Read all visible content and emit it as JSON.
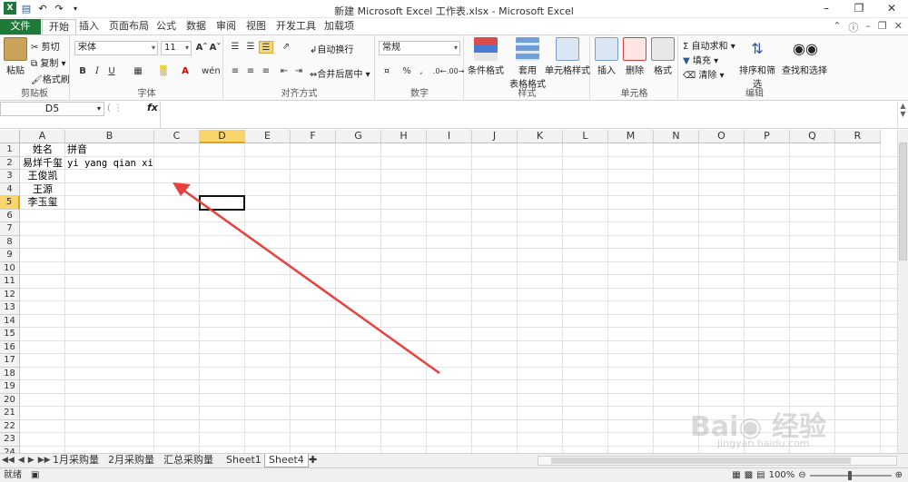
{
  "window": {
    "title": "新建 Microsoft Excel 工作表.xlsx - Microsoft Excel"
  },
  "tabs": [
    "文件",
    "开始",
    "插入",
    "页面布局",
    "公式",
    "数据",
    "审阅",
    "视图",
    "开发工具",
    "加载项"
  ],
  "ribbon": {
    "clipboard": {
      "paste": "粘贴",
      "cut": "剪切",
      "copy": "复制",
      "format_painter": "格式刷",
      "label": "剪贴板"
    },
    "font": {
      "name": "宋体",
      "size": "11",
      "bold": "B",
      "italic": "I",
      "underline": "U",
      "label": "字体",
      "phonetic": "wén"
    },
    "alignment": {
      "wrap": "自动换行",
      "merge": "合并后居中",
      "label": "对齐方式"
    },
    "number": {
      "format": "常规",
      "percent": "%",
      "comma": ",",
      "label": "数字"
    },
    "styles": {
      "conditional": "条件格式",
      "table": "套用",
      "table2": "表格格式",
      "cell": "单元格样式",
      "label": "样式"
    },
    "cells": {
      "insert": "插入",
      "delete": "删除",
      "format": "格式",
      "label": "单元格"
    },
    "editing": {
      "autosum": "自动求和",
      "fill": "填充",
      "clear": "清除",
      "sort": "排序和筛选",
      "find": "查找和选择",
      "label": "编辑"
    }
  },
  "formula_bar": {
    "name_box": "D5",
    "fx": "fx",
    "value": ""
  },
  "columns": [
    "A",
    "B",
    "C",
    "D",
    "E",
    "F",
    "G",
    "H",
    "I",
    "J",
    "K",
    "L",
    "M",
    "N",
    "O",
    "P",
    "Q",
    "R"
  ],
  "rows": [
    "1",
    "2",
    "3",
    "4",
    "5",
    "6",
    "7",
    "8",
    "9",
    "10",
    "11",
    "12",
    "13",
    "14",
    "15",
    "16",
    "17",
    "18",
    "19",
    "20",
    "21",
    "22",
    "23",
    "24"
  ],
  "cells": {
    "A1": "姓名",
    "B1": "拼音",
    "A2": "易烊千玺",
    "B2": "yi yang qian xi",
    "A3": "王俊凯",
    "A4": "王源",
    "A5": "李玉玺"
  },
  "selected_cell": "D5",
  "sheets": [
    "1月采购量",
    "2月采购量",
    "汇总采购量",
    "Sheet1",
    "Sheet4"
  ],
  "active_sheet": "Sheet4",
  "status": {
    "ready": "就绪",
    "zoom": "100%"
  },
  "watermark": {
    "brand": "Bai du 经验",
    "url": "jingyan.baidu.com"
  },
  "colors": {
    "file_tab": "#1f7a3a",
    "selection": "#f9d66b",
    "arrow": "#e8403c"
  }
}
